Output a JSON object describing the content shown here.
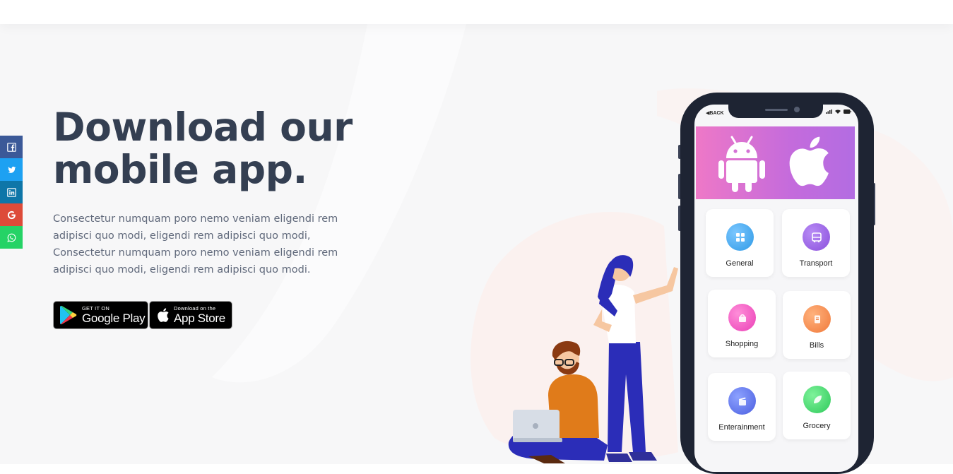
{
  "social": [
    {
      "name": "facebook",
      "icon": "facebook-icon",
      "color": "#3b5998"
    },
    {
      "name": "twitter",
      "icon": "twitter-icon",
      "color": "#1da1f2"
    },
    {
      "name": "linkedin",
      "icon": "linkedin-icon",
      "color": "#0e76a8"
    },
    {
      "name": "google",
      "icon": "google-icon",
      "color": "#dd4b39"
    },
    {
      "name": "whatsapp",
      "icon": "whatsapp-icon",
      "color": "#25d366"
    }
  ],
  "hero": {
    "headline_line1": "Download our",
    "headline_line2": "mobile app.",
    "description": [
      "Consectetur numquam poro nemo veniam eligendi rem",
      "adipisci quo modi, eligendi rem adipisci quo modi,",
      "Consectetur numquam poro nemo veniam eligendi rem",
      "adipisci quo modi, eligendi rem adipisci quo modi."
    ]
  },
  "store_buttons": {
    "google_small": "GET IT ON",
    "google_big": "Google Play",
    "apple_small": "Download on the",
    "apple_big": "App Store"
  },
  "phone": {
    "back_label": "BACK",
    "banner_icons": [
      "android-icon",
      "apple-icon"
    ],
    "tiles": [
      {
        "label": "General",
        "icon": "grid-icon",
        "color": "#2f9ae6"
      },
      {
        "label": "Transport",
        "icon": "bus-icon",
        "color": "#8a4fdc"
      },
      {
        "label": "Shopping",
        "icon": "shopping-bag-icon",
        "color": "#ea3fb6"
      },
      {
        "label": "Bills",
        "icon": "receipt-icon",
        "color": "#f0793a"
      },
      {
        "label": "Enterainment",
        "icon": "clapper-icon",
        "color": "#4a5ee0"
      },
      {
        "label": "Grocery",
        "icon": "leaf-icon",
        "color": "#2ec95a"
      }
    ]
  },
  "colors": {
    "heading": "#343f52",
    "body_text": "#60697b",
    "hero_bg": "#f7f7f8",
    "phone_frame": "#1e2433"
  }
}
